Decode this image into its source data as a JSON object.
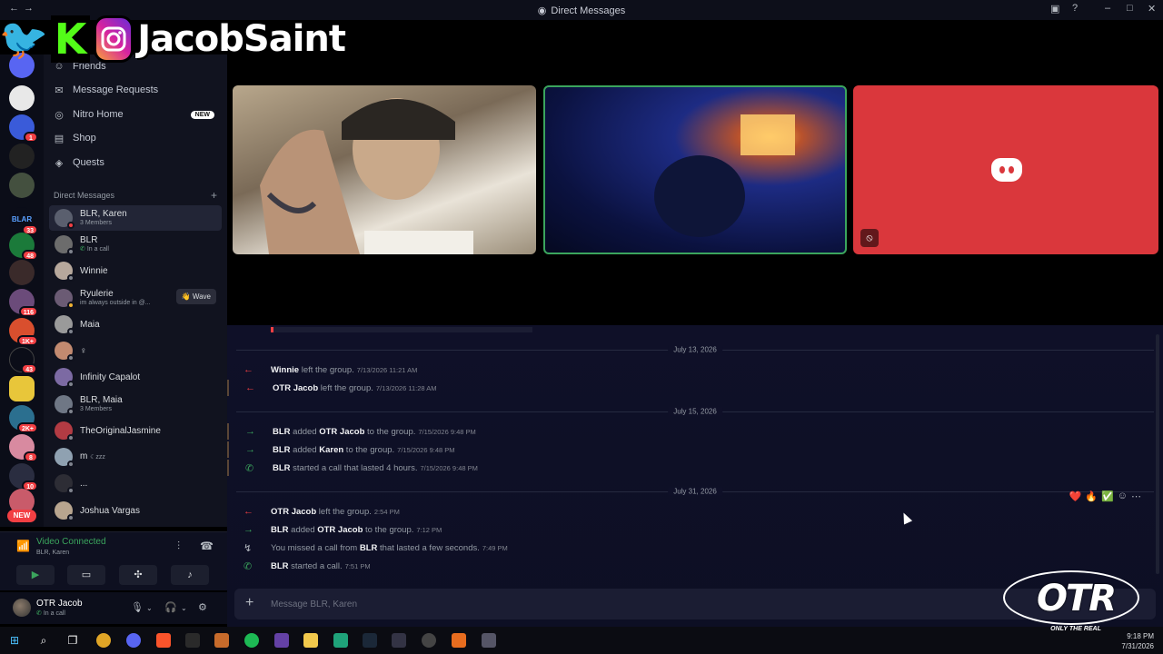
{
  "window": {
    "title": "Direct Messages",
    "title_icon": "discord-icon"
  },
  "overlay": {
    "streamer_name": "JacobSaint",
    "socials": [
      "twitter-icon",
      "kick-icon",
      "instagram-icon"
    ],
    "kick_letter": "K"
  },
  "servers": {
    "badges": [
      "1",
      "33",
      "48",
      "116",
      "1K+",
      "43",
      "2K+",
      "8",
      "10"
    ],
    "new_label": "NEW"
  },
  "nav": {
    "items": [
      {
        "label": "Friends",
        "icon": "friends-icon"
      },
      {
        "label": "Message Requests",
        "icon": "mail-icon"
      },
      {
        "label": "Nitro Home",
        "icon": "nitro-icon",
        "badge": "NEW"
      },
      {
        "label": "Shop",
        "icon": "shop-icon"
      },
      {
        "label": "Quests",
        "icon": "quests-icon"
      }
    ]
  },
  "dms": {
    "header": "Direct Messages",
    "items": [
      {
        "name": "BLR, Karen",
        "sub": "3 Members",
        "active": true,
        "color": "#5a5f6e"
      },
      {
        "name": "BLR",
        "sub": "In a call",
        "color": "#6c6c6c"
      },
      {
        "name": "Winnie",
        "sub": "",
        "color": "#b7a89c"
      },
      {
        "name": "Ryulerie",
        "sub": "im always outside in @...",
        "color": "#6b5b74",
        "wave": "👋 Wave"
      },
      {
        "name": "Maia",
        "sub": "",
        "color": "#9a9a9a"
      },
      {
        "name": "♀",
        "sub": "",
        "color": "#c28a70"
      },
      {
        "name": "Infinity Capalot",
        "sub": "",
        "color": "#7c6aa3"
      },
      {
        "name": "BLR, Maia",
        "sub": "3 Members",
        "color": "#6f7785"
      },
      {
        "name": "TheOriginalJasmine",
        "sub": "",
        "color": "#b23b43"
      },
      {
        "name": "m",
        "sub": "",
        "color": "#8fa1b1",
        "tag": "zzz"
      },
      {
        "name": "...",
        "sub": "",
        "color": "#2d2d35"
      },
      {
        "name": "Joshua Vargas",
        "sub": "",
        "color": "#b8a58f"
      }
    ]
  },
  "voice": {
    "status": "Video Connected",
    "channel": "BLR, Karen"
  },
  "user": {
    "name": "OTR Jacob",
    "status": "In a call"
  },
  "chat": {
    "days": [
      {
        "label": "July 13, 2026",
        "events": [
          {
            "type": "leave",
            "actor": "Winnie",
            "text": " left the group.",
            "time": "7/13/2026 11:21 AM"
          },
          {
            "type": "leave",
            "actor": "OTR Jacob",
            "text": " left the group.",
            "time": "7/13/2026 11:28 AM"
          }
        ]
      },
      {
        "label": "July 15, 2026",
        "events": [
          {
            "type": "join",
            "actor": "BLR",
            "text": " added ",
            "target": "OTR Jacob",
            "text2": " to the group.",
            "time": "7/15/2026 9:48 PM"
          },
          {
            "type": "join",
            "actor": "BLR",
            "text": " added ",
            "target": "Karen",
            "text2": " to the group.",
            "time": "7/15/2026 9:48 PM"
          },
          {
            "type": "call",
            "actor": "BLR",
            "text": " started a call that lasted 4 hours.",
            "time": "7/15/2026 9:48 PM"
          }
        ]
      },
      {
        "label": "July 31, 2026",
        "events": [
          {
            "type": "leave",
            "actor": "OTR Jacob",
            "text": " left the group.",
            "time": "2:54 PM"
          },
          {
            "type": "join",
            "actor": "BLR",
            "text": " added ",
            "target": "OTR Jacob",
            "text2": " to the group.",
            "time": "7:12 PM"
          },
          {
            "type": "missed",
            "prefix": "You missed a call from ",
            "actor": "BLR",
            "text": " that lasted a few seconds.",
            "time": "7:49 PM"
          },
          {
            "type": "call",
            "actor": "BLR",
            "text": " started a call.",
            "time": "7:51 PM"
          }
        ]
      }
    ],
    "reactions": [
      "❤️",
      "🔥",
      "✅",
      "emoji-add-icon",
      "more-icon"
    ],
    "composer_placeholder": "Message BLR, Karen"
  },
  "watermark": {
    "logo_text": "OTR",
    "tagline": "ONLY THE REAL"
  },
  "taskbar": {
    "time": "9:18 PM",
    "date": "7/31/2026"
  }
}
